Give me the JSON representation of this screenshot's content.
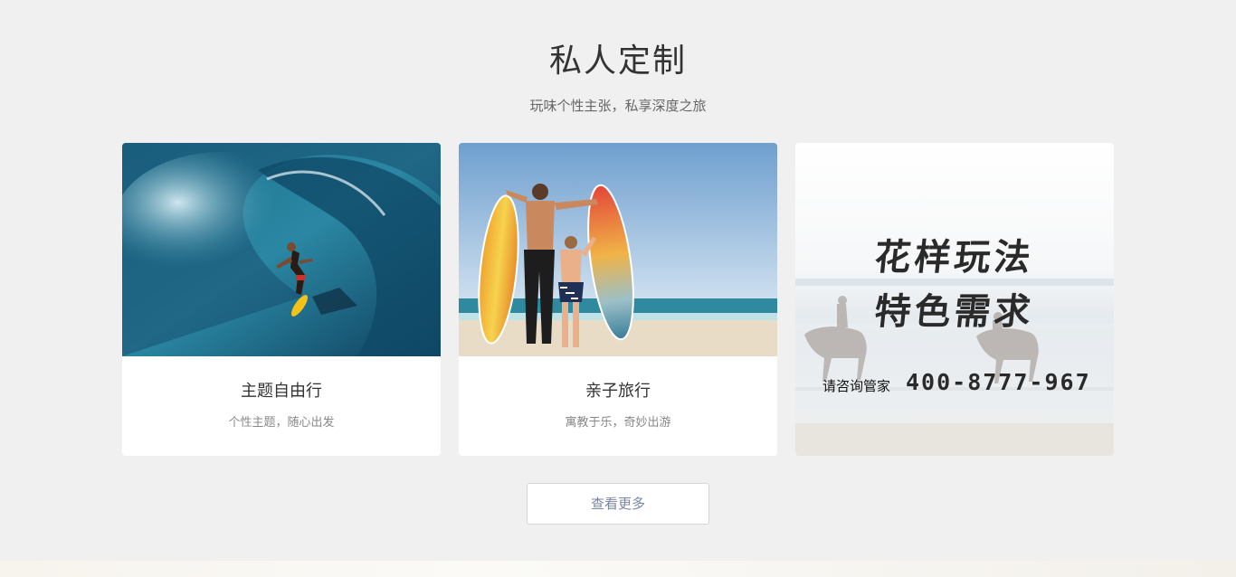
{
  "section": {
    "title": "私人定制",
    "subtitle": "玩味个性主张，私享深度之旅"
  },
  "cards": [
    {
      "name": "主题自由行",
      "desc": "个性主题，随心出发",
      "image": "surfer-in-wave"
    },
    {
      "name": "亲子旅行",
      "desc": "寓教于乐，奇妙出游",
      "image": "parent-child-surfboards-beach"
    }
  ],
  "promo": {
    "headline_line1": "花样玩法",
    "headline_line2": "特色需求",
    "contact_label": "请咨询管家",
    "phone": "400-8777-967",
    "image": "beach-horse-riders"
  },
  "more_button": {
    "label": "查看更多"
  },
  "colors": {
    "page_bg": "#f0f0f0",
    "card_bg": "#ffffff",
    "title_text": "#333333",
    "button_text": "#7b86a8"
  }
}
